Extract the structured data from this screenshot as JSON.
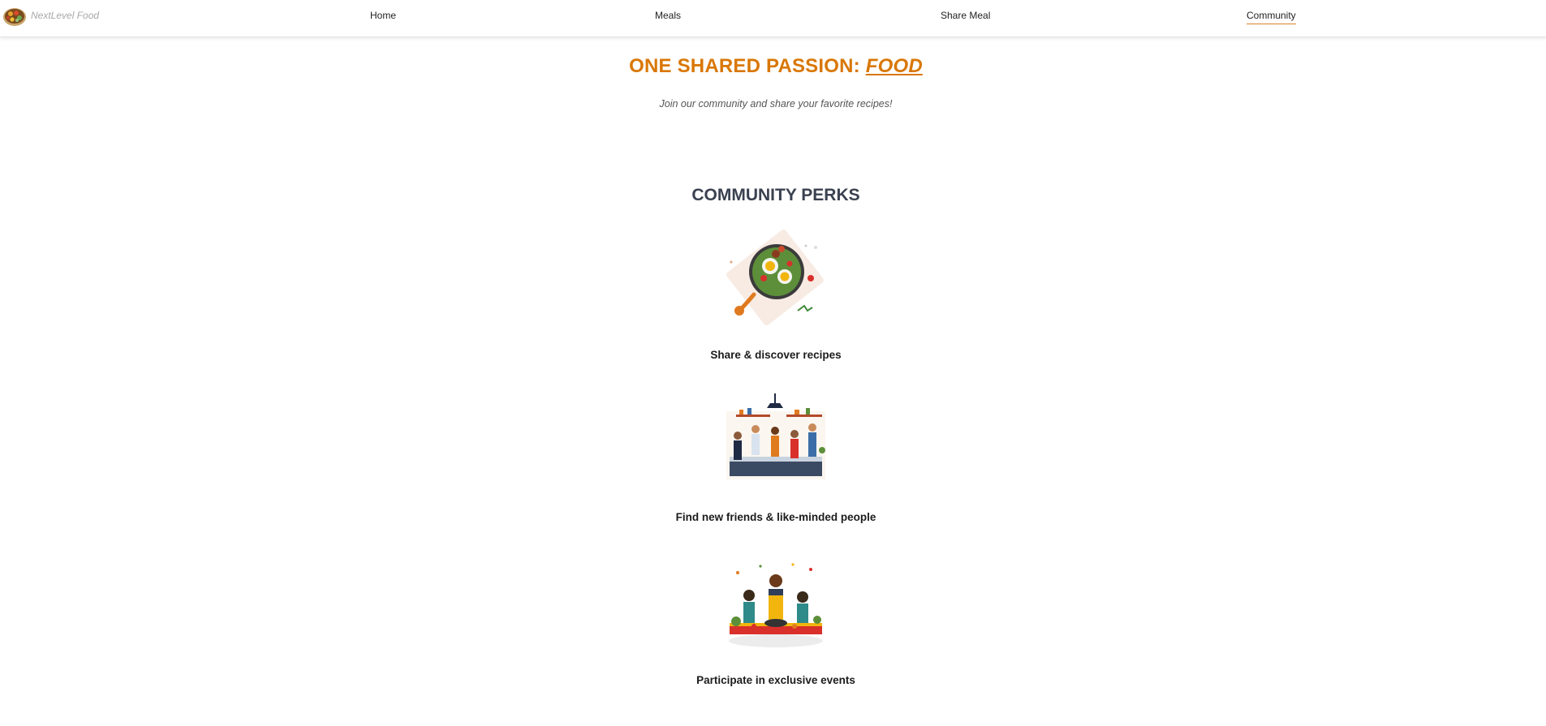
{
  "nav": {
    "brand": "NextLevel Food",
    "links": [
      {
        "label": "Home"
      },
      {
        "label": "Meals"
      },
      {
        "label": "Share Meal"
      },
      {
        "label": "Community"
      }
    ]
  },
  "hero": {
    "title_prefix": "ONE SHARED PASSION:",
    "title_accent": "FOOD",
    "subtitle": "Join our community and share your favorite recipes!"
  },
  "perks": {
    "title": "COMMUNITY PERKS",
    "items": [
      {
        "label": "Share & discover recipes",
        "image": "recipe-plate-illustration"
      },
      {
        "label": "Find new friends & like-minded people",
        "image": "kitchen-friends-illustration"
      },
      {
        "label": "Participate in exclusive events",
        "image": "cooking-event-illustration"
      }
    ]
  },
  "colors": {
    "accent": "#d97706",
    "heading": "#3a4150",
    "active_underline": "#d9822b"
  }
}
